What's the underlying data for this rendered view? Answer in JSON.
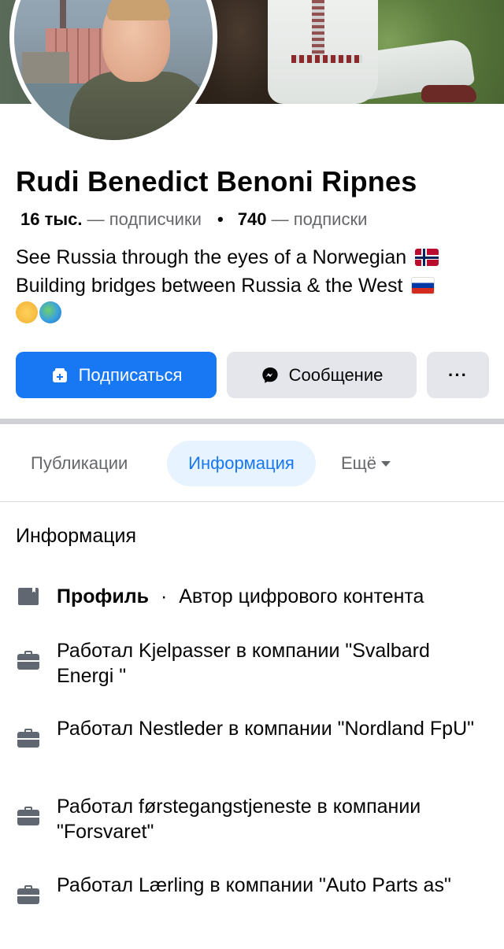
{
  "profile": {
    "name": "Rudi Benedict Benoni Ripnes",
    "followers_count": "16 тыс.",
    "followers_label": "— подписчики",
    "following_count": "740",
    "following_label": "— подписки",
    "bio_line1": "See Russia through the eyes of a Norwegian",
    "bio_line2": "Building bridges between Russia & the West",
    "bio_emojis": [
      "handshake-emoji",
      "globe-emoji"
    ]
  },
  "actions": {
    "follow_label": "Подписаться",
    "message_label": "Сообщение",
    "more_label": "···"
  },
  "tabs": [
    {
      "label": "Публикации",
      "active": false
    },
    {
      "label": "Информация",
      "active": true
    },
    {
      "label": "Ещё",
      "active": false
    }
  ],
  "info": {
    "title": "Информация",
    "profile_label": "Профиль",
    "profile_sep": "·",
    "profile_category": "Автор цифрового контента",
    "jobs": [
      {
        "text": "Работал Kjelpasser в компании \"Svalbard Energi \""
      },
      {
        "text": "Работал Nestleder в компании \"Nordland FpU\""
      },
      {
        "text": "Работал førstegangstjeneste в компании \"Forsvaret\""
      },
      {
        "text": "Работал Lærling в компании \"Auto Parts as\""
      }
    ]
  },
  "colors": {
    "accent": "#1877f2",
    "button_secondary": "#e4e6eb",
    "tab_active_bg": "#e7f3ff",
    "secondary_text": "#65676b"
  }
}
